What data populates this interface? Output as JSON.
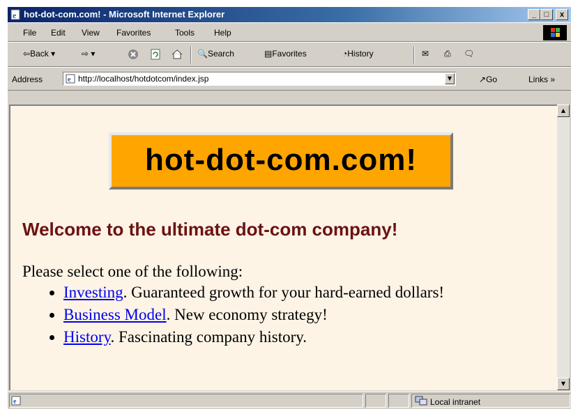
{
  "window": {
    "title": "hot-dot-com.com! - Microsoft Internet Explorer",
    "min": "_",
    "max": "□",
    "close": "x"
  },
  "menu": {
    "file": "File",
    "edit": "Edit",
    "view": "View",
    "favorites": "Favorites",
    "tools": "Tools",
    "help": "Help"
  },
  "toolbar": {
    "back": "Back",
    "search": "Search",
    "favorites": "Favorites",
    "history": "History"
  },
  "address": {
    "label": "Address",
    "url": "http://localhost/hotdotcom/index.jsp",
    "go": "Go",
    "links": "Links"
  },
  "page": {
    "logo": "hot-dot-com.com!",
    "heading": "Welcome to the ultimate dot-com company!",
    "intro": "Please select one of the following:",
    "items": [
      {
        "link": "Investing",
        "text": ". Guaranteed growth for your hard-earned dollars!"
      },
      {
        "link": "Business Model",
        "text": ". New economy strategy!"
      },
      {
        "link": "History",
        "text": ". Fascinating company history."
      }
    ]
  },
  "status": {
    "zone": "Local intranet"
  },
  "colors": {
    "titlebar": "#0a246a",
    "chrome": "#d4d0c8",
    "page_bg": "#fdf4e6",
    "logo_bg": "#ffa500",
    "heading": "#6b1212",
    "link": "#0000ee"
  },
  "icons": [
    "ie-page-icon",
    "back-arrow-icon",
    "forward-arrow-icon",
    "stop-icon",
    "refresh-icon",
    "home-icon",
    "search-icon",
    "favorites-icon",
    "history-icon",
    "mail-icon",
    "print-icon",
    "edit-icon",
    "discuss-icon",
    "go-arrow-icon",
    "intranet-icon",
    "windows-logo-icon"
  ]
}
